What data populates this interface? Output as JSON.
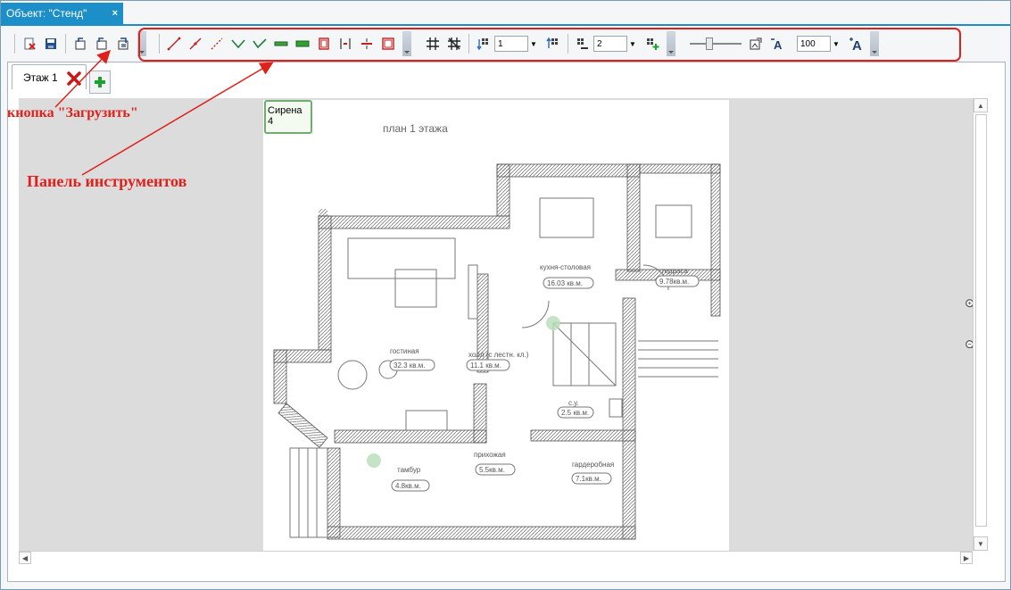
{
  "document_tab": {
    "title": "Объект: \"Стенд\"",
    "close_glyph": "×"
  },
  "toolbar": {
    "floor_spin_value": "1",
    "sensor_spin_value": "2",
    "text_size_value": "100",
    "dropdown_glyph": "▼"
  },
  "floor_tabs": [
    {
      "label": "Этаж 1"
    }
  ],
  "canvas": {
    "marker_label": "Сирена 4",
    "plan_title": "план 1 этажа",
    "rooms": [
      {
        "name": "кухня-столовая",
        "area": "16.03 кв.м."
      },
      {
        "name": "терраса",
        "area": "9.78кв.м."
      },
      {
        "name": "гостиная",
        "area": "32.3 кв.м."
      },
      {
        "name": "холл (с лестн. кл.)",
        "area": "11.1 кв.м."
      },
      {
        "name": "с.у.",
        "area": "2.5 кв.м."
      },
      {
        "name": "тамбур",
        "area": "4.8кв.м."
      },
      {
        "name": "прихожая",
        "area": "5.5кв.м."
      },
      {
        "name": "гардеробная",
        "area": "7.1кв.м."
      }
    ]
  },
  "annotations": {
    "load_button_label": "кнопка \"Загрузить\"",
    "toolbar_label": "Панель инструментов",
    "color": "#e0201a"
  },
  "colors": {
    "accent": "#1d8fc8",
    "marker_border": "#6fae6f",
    "annotation": "#e0201a"
  }
}
